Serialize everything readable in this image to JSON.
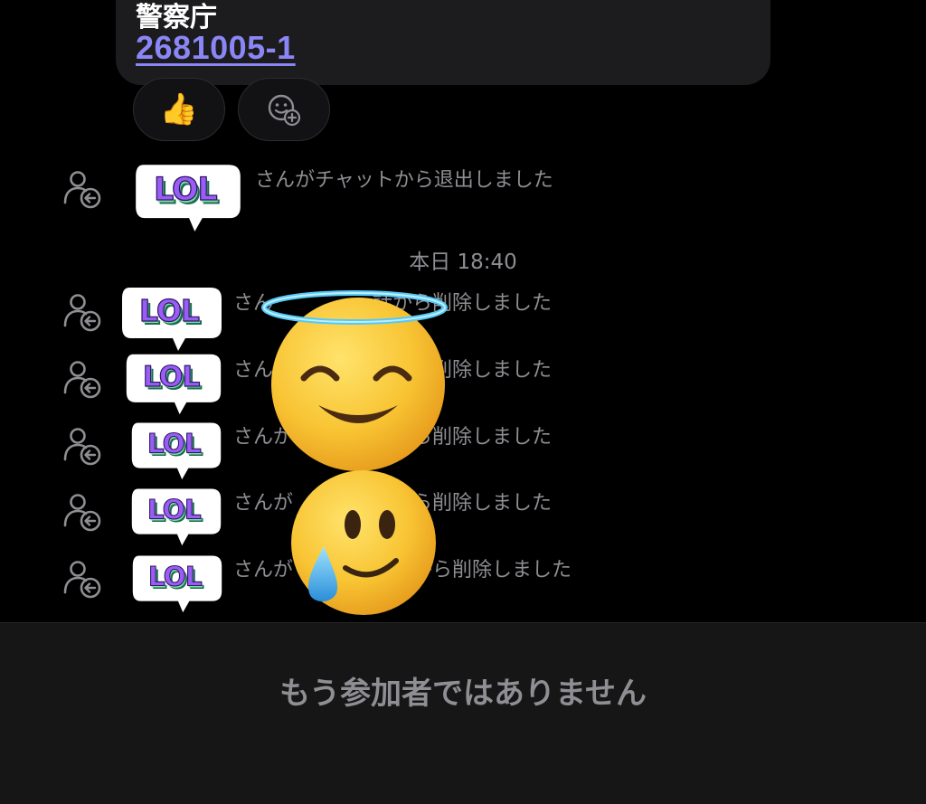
{
  "message": {
    "title": "警察庁",
    "link_text": "2681005-1"
  },
  "reactions": [
    {
      "icon": "thumbs-up-emoji",
      "glyph": "👍"
    },
    {
      "icon": "add-reaction-icon"
    }
  ],
  "events": [
    {
      "icon": "person-leave-icon",
      "text": "さんがチャットから退出しました",
      "sticker": "LOL"
    },
    {
      "icon": "person-leave-icon",
      "text": "さん　　　　　話から削除しました",
      "sticker": "LOL"
    },
    {
      "icon": "person-leave-icon",
      "text": "さん　　　　　話から削除しました",
      "sticker": "LOL"
    },
    {
      "icon": "person-leave-icon",
      "text": "さんが　　　　話から削除しました",
      "sticker": "LOL"
    },
    {
      "icon": "person-leave-icon",
      "text": "さんが　　　会話から削除しました",
      "sticker": "LOL"
    },
    {
      "icon": "person-leave-icon",
      "text": "さんが　　　を会話から削除しました",
      "sticker": "LOL"
    }
  ],
  "date_separator": "本日 18:40",
  "overlay_stickers": [
    "smiling-face-with-halo-emoji",
    "smiling-face-with-tear-emoji"
  ],
  "footer": {
    "text": "もう参加者ではありません"
  },
  "colors": {
    "background": "#000000",
    "bubble": "#1c1c1e",
    "link": "#8a86f5",
    "secondary_text": "#8e8e93",
    "footer_bg": "#161616",
    "lol_purple": "#9b5cf6",
    "lol_green": "#7fe0a0"
  }
}
